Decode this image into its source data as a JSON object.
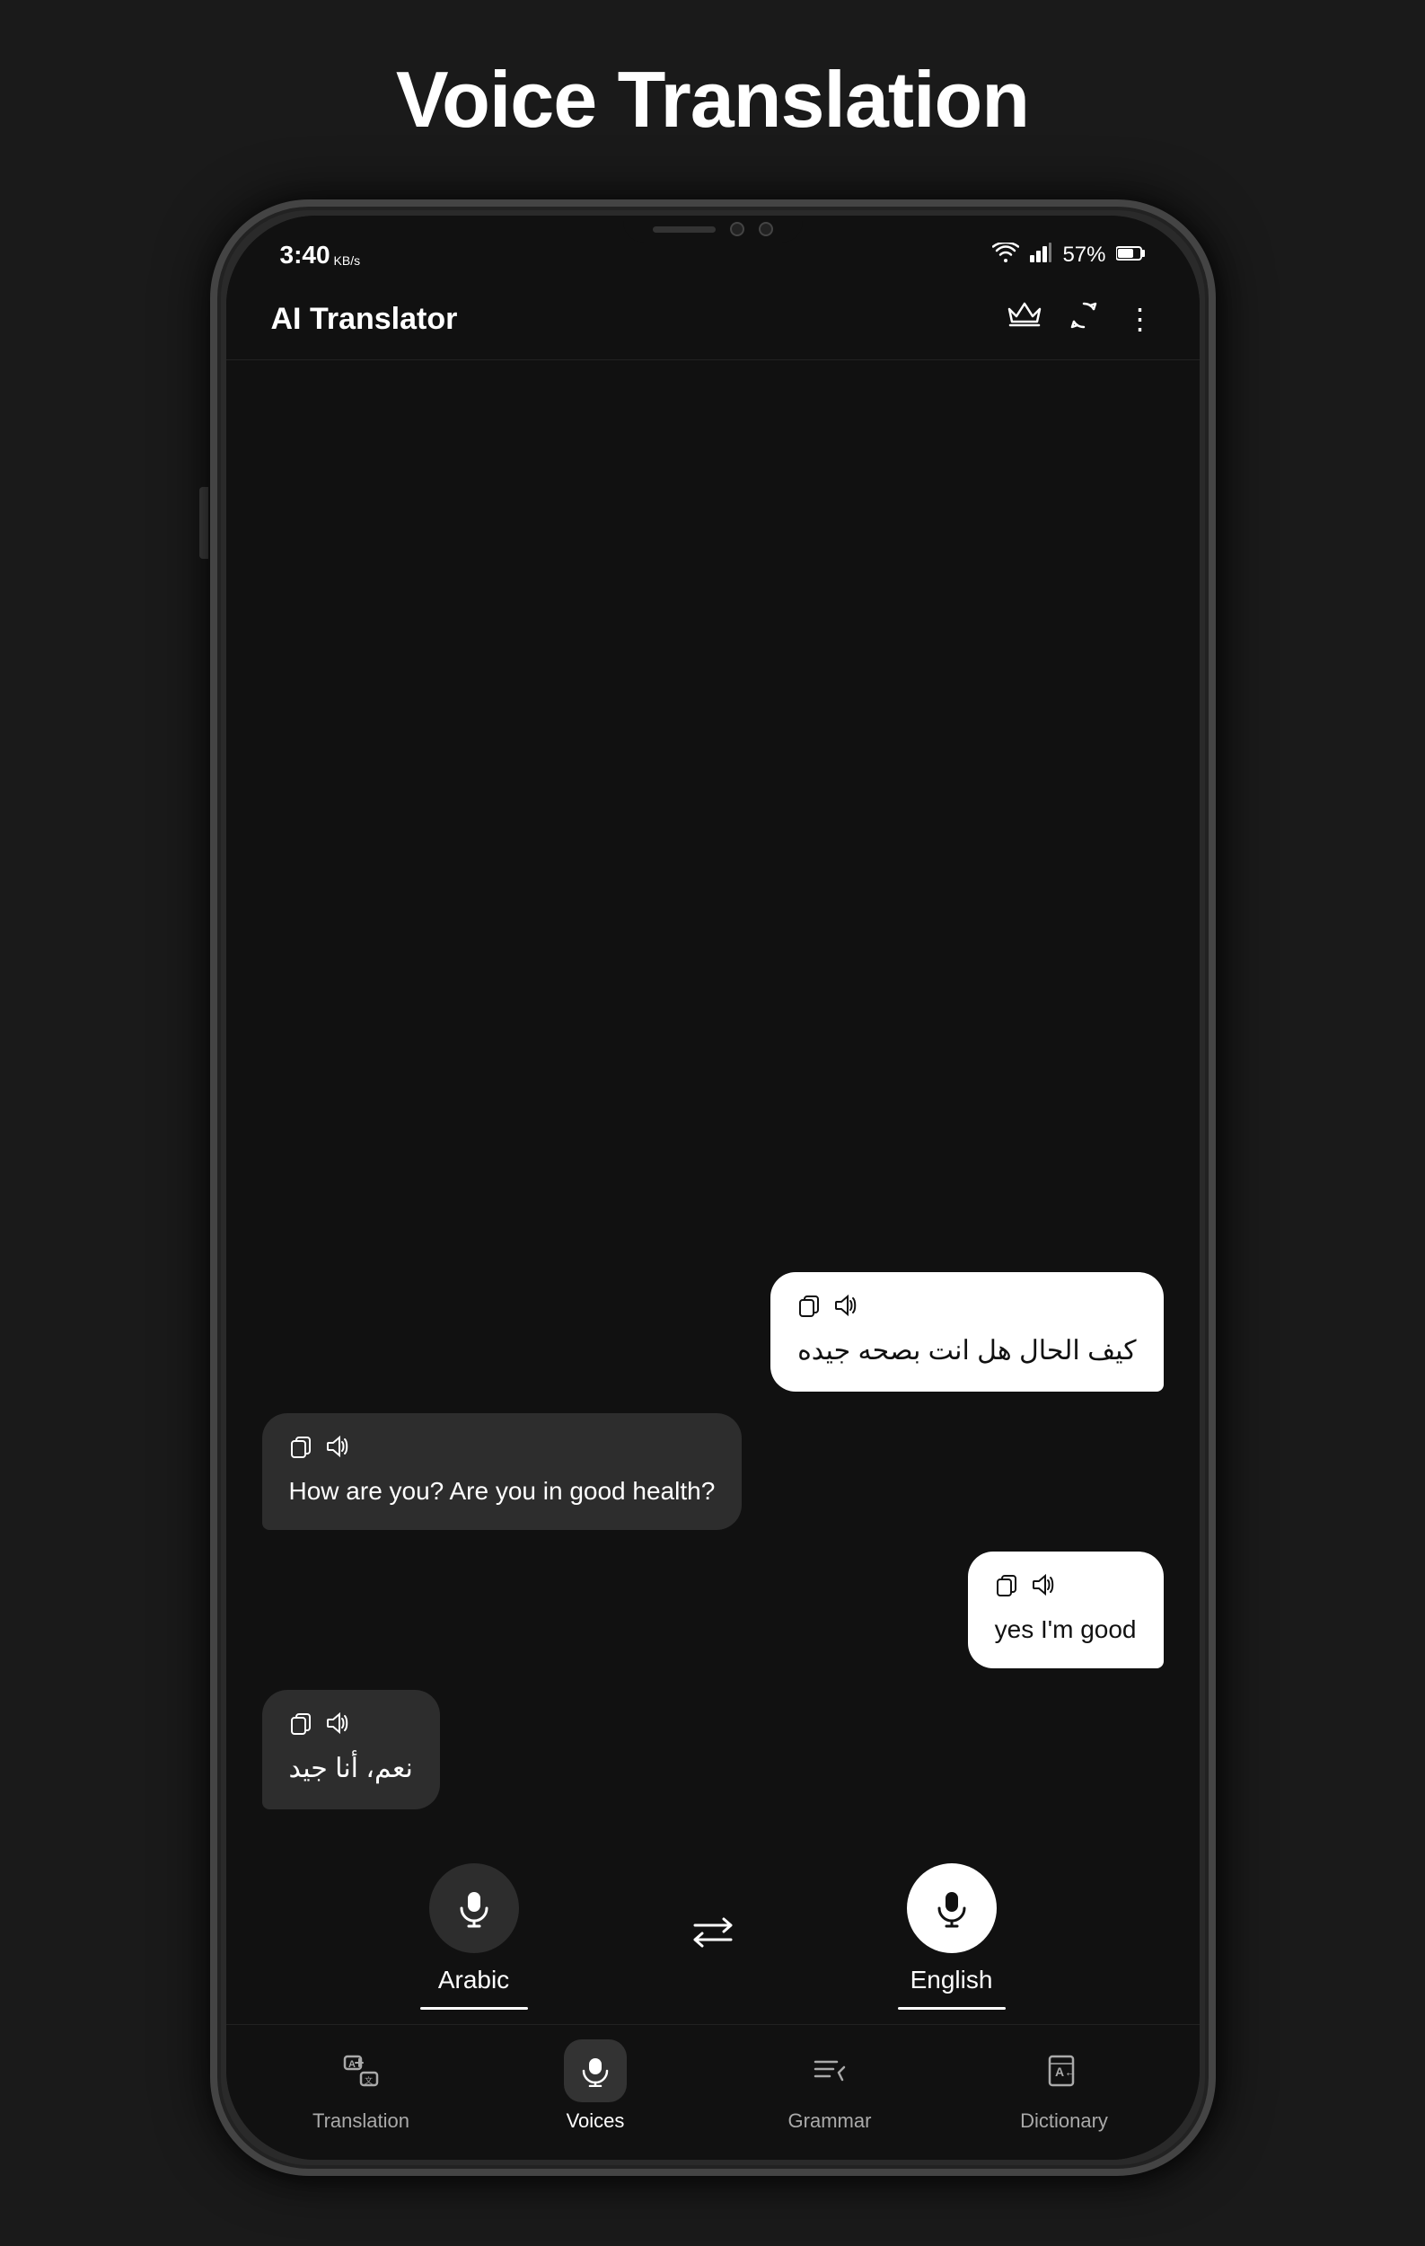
{
  "page": {
    "title": "Voice Translation",
    "background": "#1a1a1a"
  },
  "status_bar": {
    "time": "3:40",
    "kb": "KB/s",
    "battery": "57%",
    "battery_icon": "🔋",
    "signal_icon": "📶",
    "wifi_icon": "📡"
  },
  "app_header": {
    "title": "AI Translator",
    "crown_icon": "♛",
    "refresh_icon": "↻",
    "menu_icon": "⋮"
  },
  "chat": {
    "messages": [
      {
        "id": 1,
        "side": "right",
        "text": "كيف الحال هل انت بصحه جيده",
        "copy_icon": "📋",
        "speaker_icon": "🔊",
        "is_arabic": true
      },
      {
        "id": 2,
        "side": "left",
        "text": "How are you? Are you in good health?",
        "copy_icon": "📋",
        "speaker_icon": "🔊",
        "is_arabic": false
      },
      {
        "id": 3,
        "side": "right",
        "text": "yes I'm good",
        "copy_icon": "📋",
        "speaker_icon": "🔊",
        "is_arabic": false
      },
      {
        "id": 4,
        "side": "left",
        "text": "نعم، أنا جيد",
        "copy_icon": "📋",
        "speaker_icon": "🔊",
        "is_arabic": true
      }
    ]
  },
  "language_controls": {
    "left_lang": "Arabic",
    "right_lang": "English",
    "swap_icon": "⇄"
  },
  "bottom_nav": {
    "items": [
      {
        "id": "translation",
        "label": "Translation",
        "active": false
      },
      {
        "id": "voices",
        "label": "Voices",
        "active": true
      },
      {
        "id": "grammar",
        "label": "Grammar",
        "active": false
      },
      {
        "id": "dictionary",
        "label": "Dictionary",
        "active": false
      }
    ]
  }
}
